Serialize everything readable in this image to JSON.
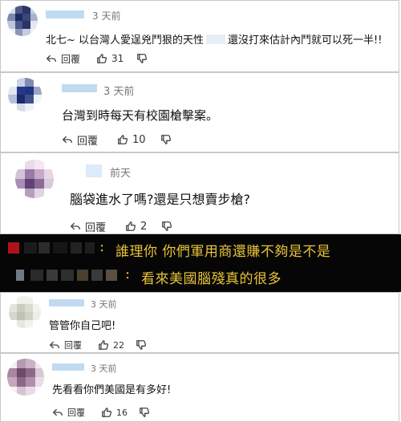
{
  "comments": [
    {
      "time": "3 天前",
      "text_a": "北七~ 以台灣人愛逞兇鬥狠的天性",
      "text_b": "還沒打來估計內鬥就可以死一半!!",
      "reply": "回覆",
      "likes": "31"
    },
    {
      "time": "3 天前",
      "text": "台灣到時每天有校園槍擊案。",
      "reply": "回覆",
      "likes": "10"
    },
    {
      "time": "前天",
      "text": "腦袋進水了嗎?還是只想賣步槍?",
      "reply": "回覆",
      "likes": "2"
    },
    {
      "time": "3 天前",
      "text": "管管你自己吧!",
      "reply": "回覆",
      "likes": "22"
    },
    {
      "time": "3 天前",
      "text": "先看看你們美國是有多好!",
      "reply": "回覆",
      "likes": "16"
    }
  ],
  "banner": {
    "line1": "誰理你 你們軍用商還賺不夠是不是",
    "line2": "看來美國腦殘真的很多"
  },
  "icons": {
    "reply": "reply-arrow-icon",
    "like": "thumbs-up-icon",
    "dislike": "thumbs-down-icon"
  }
}
